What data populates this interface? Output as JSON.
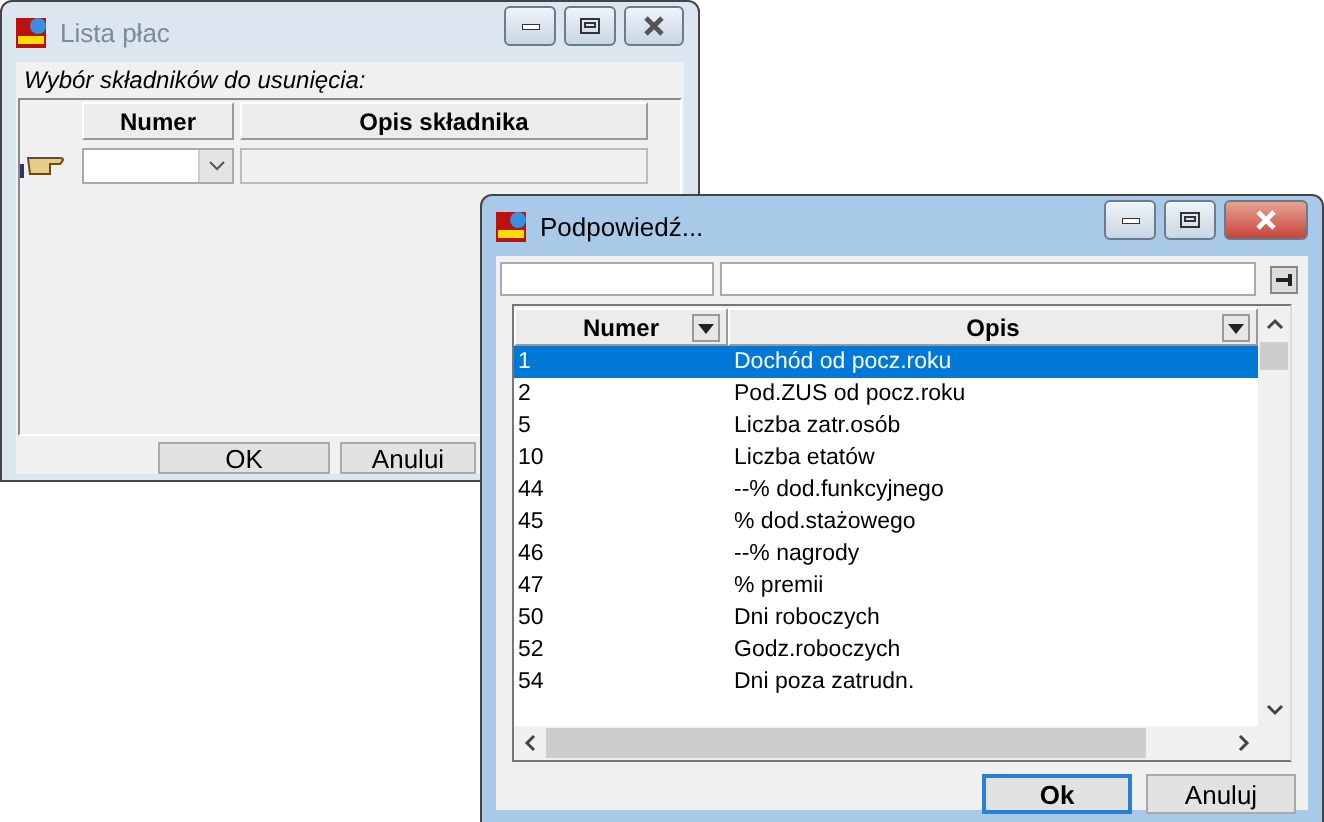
{
  "windows": [
    {
      "title": "Lista płac",
      "active": false,
      "prompt": "Wybór składników do usunięcia:",
      "columns": [
        "Numer",
        "Opis składnika"
      ],
      "buttons": [
        {
          "label": "OK",
          "default": false
        },
        {
          "label": "Anului",
          "default": false
        }
      ]
    },
    {
      "title": "Podpowiedź...",
      "active": true,
      "columns": [
        "Numer",
        "Opis"
      ],
      "rows": [
        {
          "numer": "1",
          "opis": "Dochód od pocz.roku",
          "selected": true
        },
        {
          "numer": "2",
          "opis": "Pod.ZUS od pocz.roku",
          "selected": false
        },
        {
          "numer": "5",
          "opis": "Liczba zatr.osób",
          "selected": false
        },
        {
          "numer": "10",
          "opis": "Liczba etatów",
          "selected": false
        },
        {
          "numer": "44",
          "opis": "--% dod.funkcyjnego",
          "selected": false
        },
        {
          "numer": "45",
          "opis": "% dod.stażowego",
          "selected": false
        },
        {
          "numer": "46",
          "opis": "--% nagrody",
          "selected": false
        },
        {
          "numer": "47",
          "opis": "% premii",
          "selected": false
        },
        {
          "numer": "50",
          "opis": "Dni roboczych",
          "selected": false
        },
        {
          "numer": "52",
          "opis": "Godz.roboczych",
          "selected": false
        },
        {
          "numer": "54",
          "opis": "Dni poza zatrudn.",
          "selected": false
        }
      ],
      "buttons": [
        {
          "label": "Ok",
          "default": true
        },
        {
          "label": "Anuluj",
          "default": false
        }
      ]
    }
  ]
}
